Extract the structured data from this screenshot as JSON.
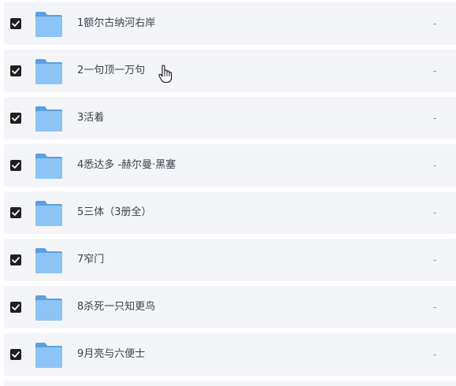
{
  "file_list": {
    "rows": [
      {
        "name": "1额尔古纳河右岸",
        "size": "-",
        "checked": true,
        "icon": "folder-icon"
      },
      {
        "name": "2一句顶一万句",
        "size": "-",
        "checked": true,
        "icon": "folder-icon"
      },
      {
        "name": "3活着",
        "size": "-",
        "checked": true,
        "icon": "folder-icon"
      },
      {
        "name": "4悉达多 -赫尔曼·黑塞",
        "size": "-",
        "checked": true,
        "icon": "folder-icon"
      },
      {
        "name": "5三体（3册全）",
        "size": "-",
        "checked": true,
        "icon": "folder-icon"
      },
      {
        "name": "7窄门",
        "size": "-",
        "checked": true,
        "icon": "folder-icon"
      },
      {
        "name": "8杀死一只知更鸟",
        "size": "-",
        "checked": true,
        "icon": "folder-icon"
      },
      {
        "name": "9月亮与六便士",
        "size": "-",
        "checked": true,
        "icon": "folder-icon"
      }
    ]
  },
  "cursor": {
    "icon": "hand-pointer-icon"
  },
  "colors": {
    "row_background": "#f3f4f7",
    "checkbox_fill": "#1f1f1f",
    "folder_blue": "#7bb8f0",
    "text": "#3b3f4a"
  }
}
